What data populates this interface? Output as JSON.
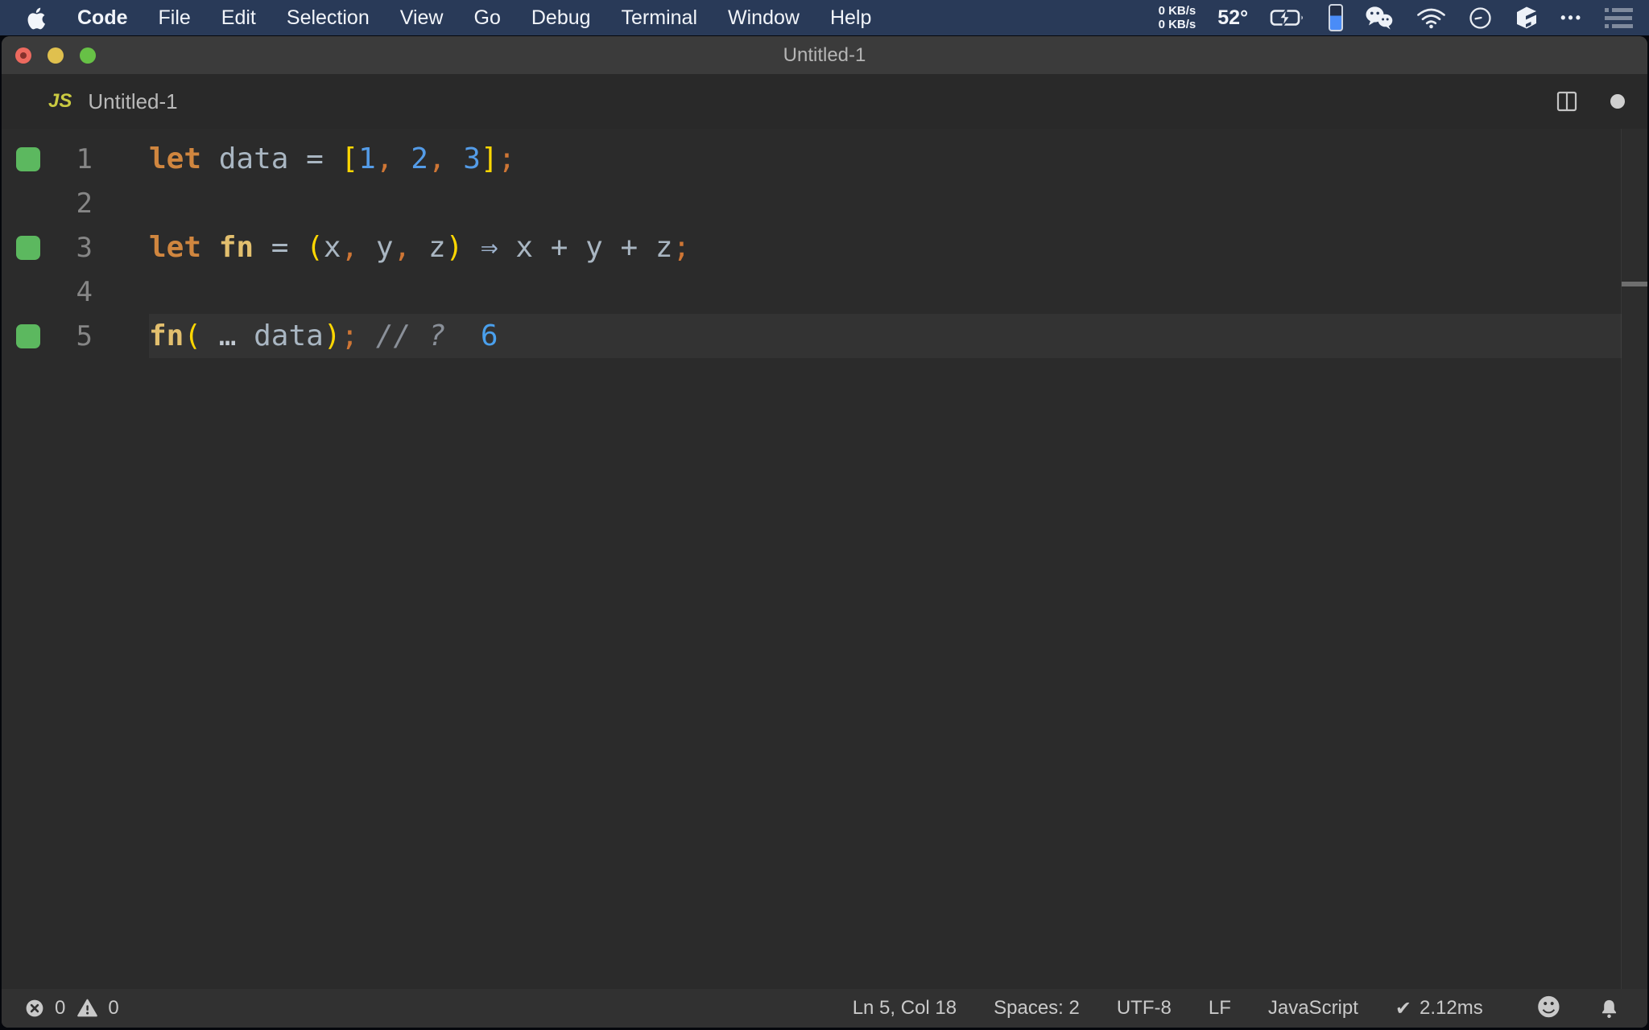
{
  "menu_bar": {
    "app_name": "Code",
    "items": [
      "File",
      "Edit",
      "Selection",
      "View",
      "Go",
      "Debug",
      "Terminal",
      "Window",
      "Help"
    ],
    "net_up": "0 KB/s",
    "net_down": "0 KB/s",
    "temperature": "52°",
    "ellipsis_glyph": "•••"
  },
  "window": {
    "title": "Untitled-1"
  },
  "tab_bar": {
    "file_type_badge": "JS",
    "file_name": "Untitled-1"
  },
  "editor": {
    "coverage_color": "#5cb85f",
    "token_colors": {
      "kw": "#d0863f",
      "pl": "#a9b6c2",
      "vr": "#a9b6c2",
      "op": "#a9b6c2",
      "br": "#ffd702",
      "nm": "#549ce8",
      "pu": "#cf7635",
      "fn": "#e2bf6e",
      "ar": "#9fb4cf",
      "sp": "#c3cbd4",
      "cm": "#8a9099",
      "rs": "#4aa0ed"
    },
    "lines": [
      {
        "num": "1",
        "coverage": true,
        "current": false,
        "tokens": [
          [
            "kw",
            "let"
          ],
          [
            "pl",
            " "
          ],
          [
            "vr",
            "data"
          ],
          [
            "pl",
            " "
          ],
          [
            "op",
            "="
          ],
          [
            "pl",
            " "
          ],
          [
            "br",
            "["
          ],
          [
            "nm",
            "1"
          ],
          [
            "pu",
            ","
          ],
          [
            "pl",
            " "
          ],
          [
            "nm",
            "2"
          ],
          [
            "pu",
            ","
          ],
          [
            "pl",
            " "
          ],
          [
            "nm",
            "3"
          ],
          [
            "br",
            "]"
          ],
          [
            "pu",
            ";"
          ]
        ]
      },
      {
        "num": "2",
        "coverage": false,
        "current": false,
        "tokens": []
      },
      {
        "num": "3",
        "coverage": true,
        "current": false,
        "tokens": [
          [
            "kw",
            "let"
          ],
          [
            "pl",
            " "
          ],
          [
            "fn",
            "fn"
          ],
          [
            "pl",
            " "
          ],
          [
            "op",
            "="
          ],
          [
            "pl",
            " "
          ],
          [
            "br",
            "("
          ],
          [
            "vr",
            "x"
          ],
          [
            "pu",
            ","
          ],
          [
            "pl",
            " "
          ],
          [
            "vr",
            "y"
          ],
          [
            "pu",
            ","
          ],
          [
            "pl",
            " "
          ],
          [
            "vr",
            "z"
          ],
          [
            "br",
            ")"
          ],
          [
            "pl",
            " "
          ],
          [
            "ar",
            "⇒"
          ],
          [
            "pl",
            " "
          ],
          [
            "vr",
            "x"
          ],
          [
            "pl",
            " "
          ],
          [
            "op",
            "+"
          ],
          [
            "pl",
            " "
          ],
          [
            "vr",
            "y"
          ],
          [
            "pl",
            " "
          ],
          [
            "op",
            "+"
          ],
          [
            "pl",
            " "
          ],
          [
            "vr",
            "z"
          ],
          [
            "pu",
            ";"
          ]
        ]
      },
      {
        "num": "4",
        "coverage": false,
        "current": false,
        "tokens": []
      },
      {
        "num": "5",
        "coverage": true,
        "current": true,
        "tokens": [
          [
            "fn",
            "fn"
          ],
          [
            "br",
            "("
          ],
          [
            "pl",
            " "
          ],
          [
            "sp",
            "…"
          ],
          [
            "pl",
            " "
          ],
          [
            "vr",
            "data"
          ],
          [
            "br",
            ")"
          ],
          [
            "pu",
            ";"
          ],
          [
            "cm",
            " // ?"
          ],
          [
            "pl",
            "  "
          ],
          [
            "rs",
            "6"
          ]
        ]
      }
    ]
  },
  "status_bar": {
    "errors": "0",
    "warnings": "0",
    "cursor_position": "Ln 5, Col 18",
    "indentation": "Spaces: 2",
    "encoding": "UTF-8",
    "eol": "LF",
    "language": "JavaScript",
    "quokka_check": "✔",
    "quokka_time": "2.12ms"
  },
  "colors": {
    "menu_bar_bg": "#293a58",
    "title_bar_bg": "#3b3b3b",
    "tab_bar_bg": "#292929",
    "editor_bg": "#2b2b2b",
    "current_line_bg": "#333333",
    "status_bar_bg": "#313131",
    "coverage_green": "#5cb85f",
    "traffic_red": "#ed6a5f",
    "traffic_yellow": "#e0c04e",
    "traffic_green": "#67c146",
    "js_badge_yellow": "#cbcb41",
    "blue_widget_fill": "#4a8cf7"
  }
}
